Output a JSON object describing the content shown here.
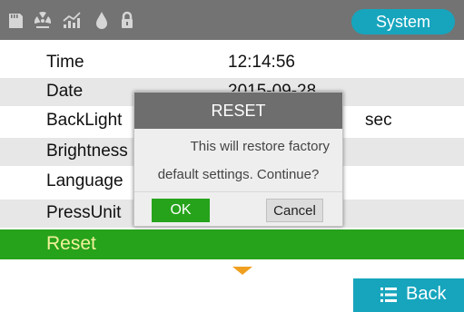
{
  "status_bar": {
    "icons": [
      "sd-card-icon",
      "radiation-icon",
      "trend-chart-icon",
      "water-drop-icon",
      "lock-icon"
    ],
    "system_tab_label": "System"
  },
  "settings": {
    "rows": [
      {
        "label": "Time",
        "value": "12:14:56",
        "unit": ""
      },
      {
        "label": "Date",
        "value": "2015-09-28",
        "unit": ""
      },
      {
        "label": "BackLight",
        "value": "",
        "unit": "sec"
      },
      {
        "label": "Brightness",
        "value": "",
        "unit": ""
      },
      {
        "label": "Language",
        "value": "",
        "unit": ""
      },
      {
        "label": "PressUnit",
        "value": "",
        "unit": ""
      }
    ],
    "selected_label": "Reset"
  },
  "dialog": {
    "title": "RESET",
    "message_line1": "This will restore factory",
    "message_line2": "default settings. Continue?",
    "ok_label": "OK",
    "cancel_label": "Cancel"
  },
  "footer": {
    "back_label": "Back",
    "scroll_indicator": "chevron-down-icon"
  },
  "colors": {
    "header_bg": "#737373",
    "accent_blue": "#16a5bd",
    "selection_green": "#26a31b",
    "selection_text": "#f3f19b",
    "scroll_arrow": "#f0a020"
  }
}
